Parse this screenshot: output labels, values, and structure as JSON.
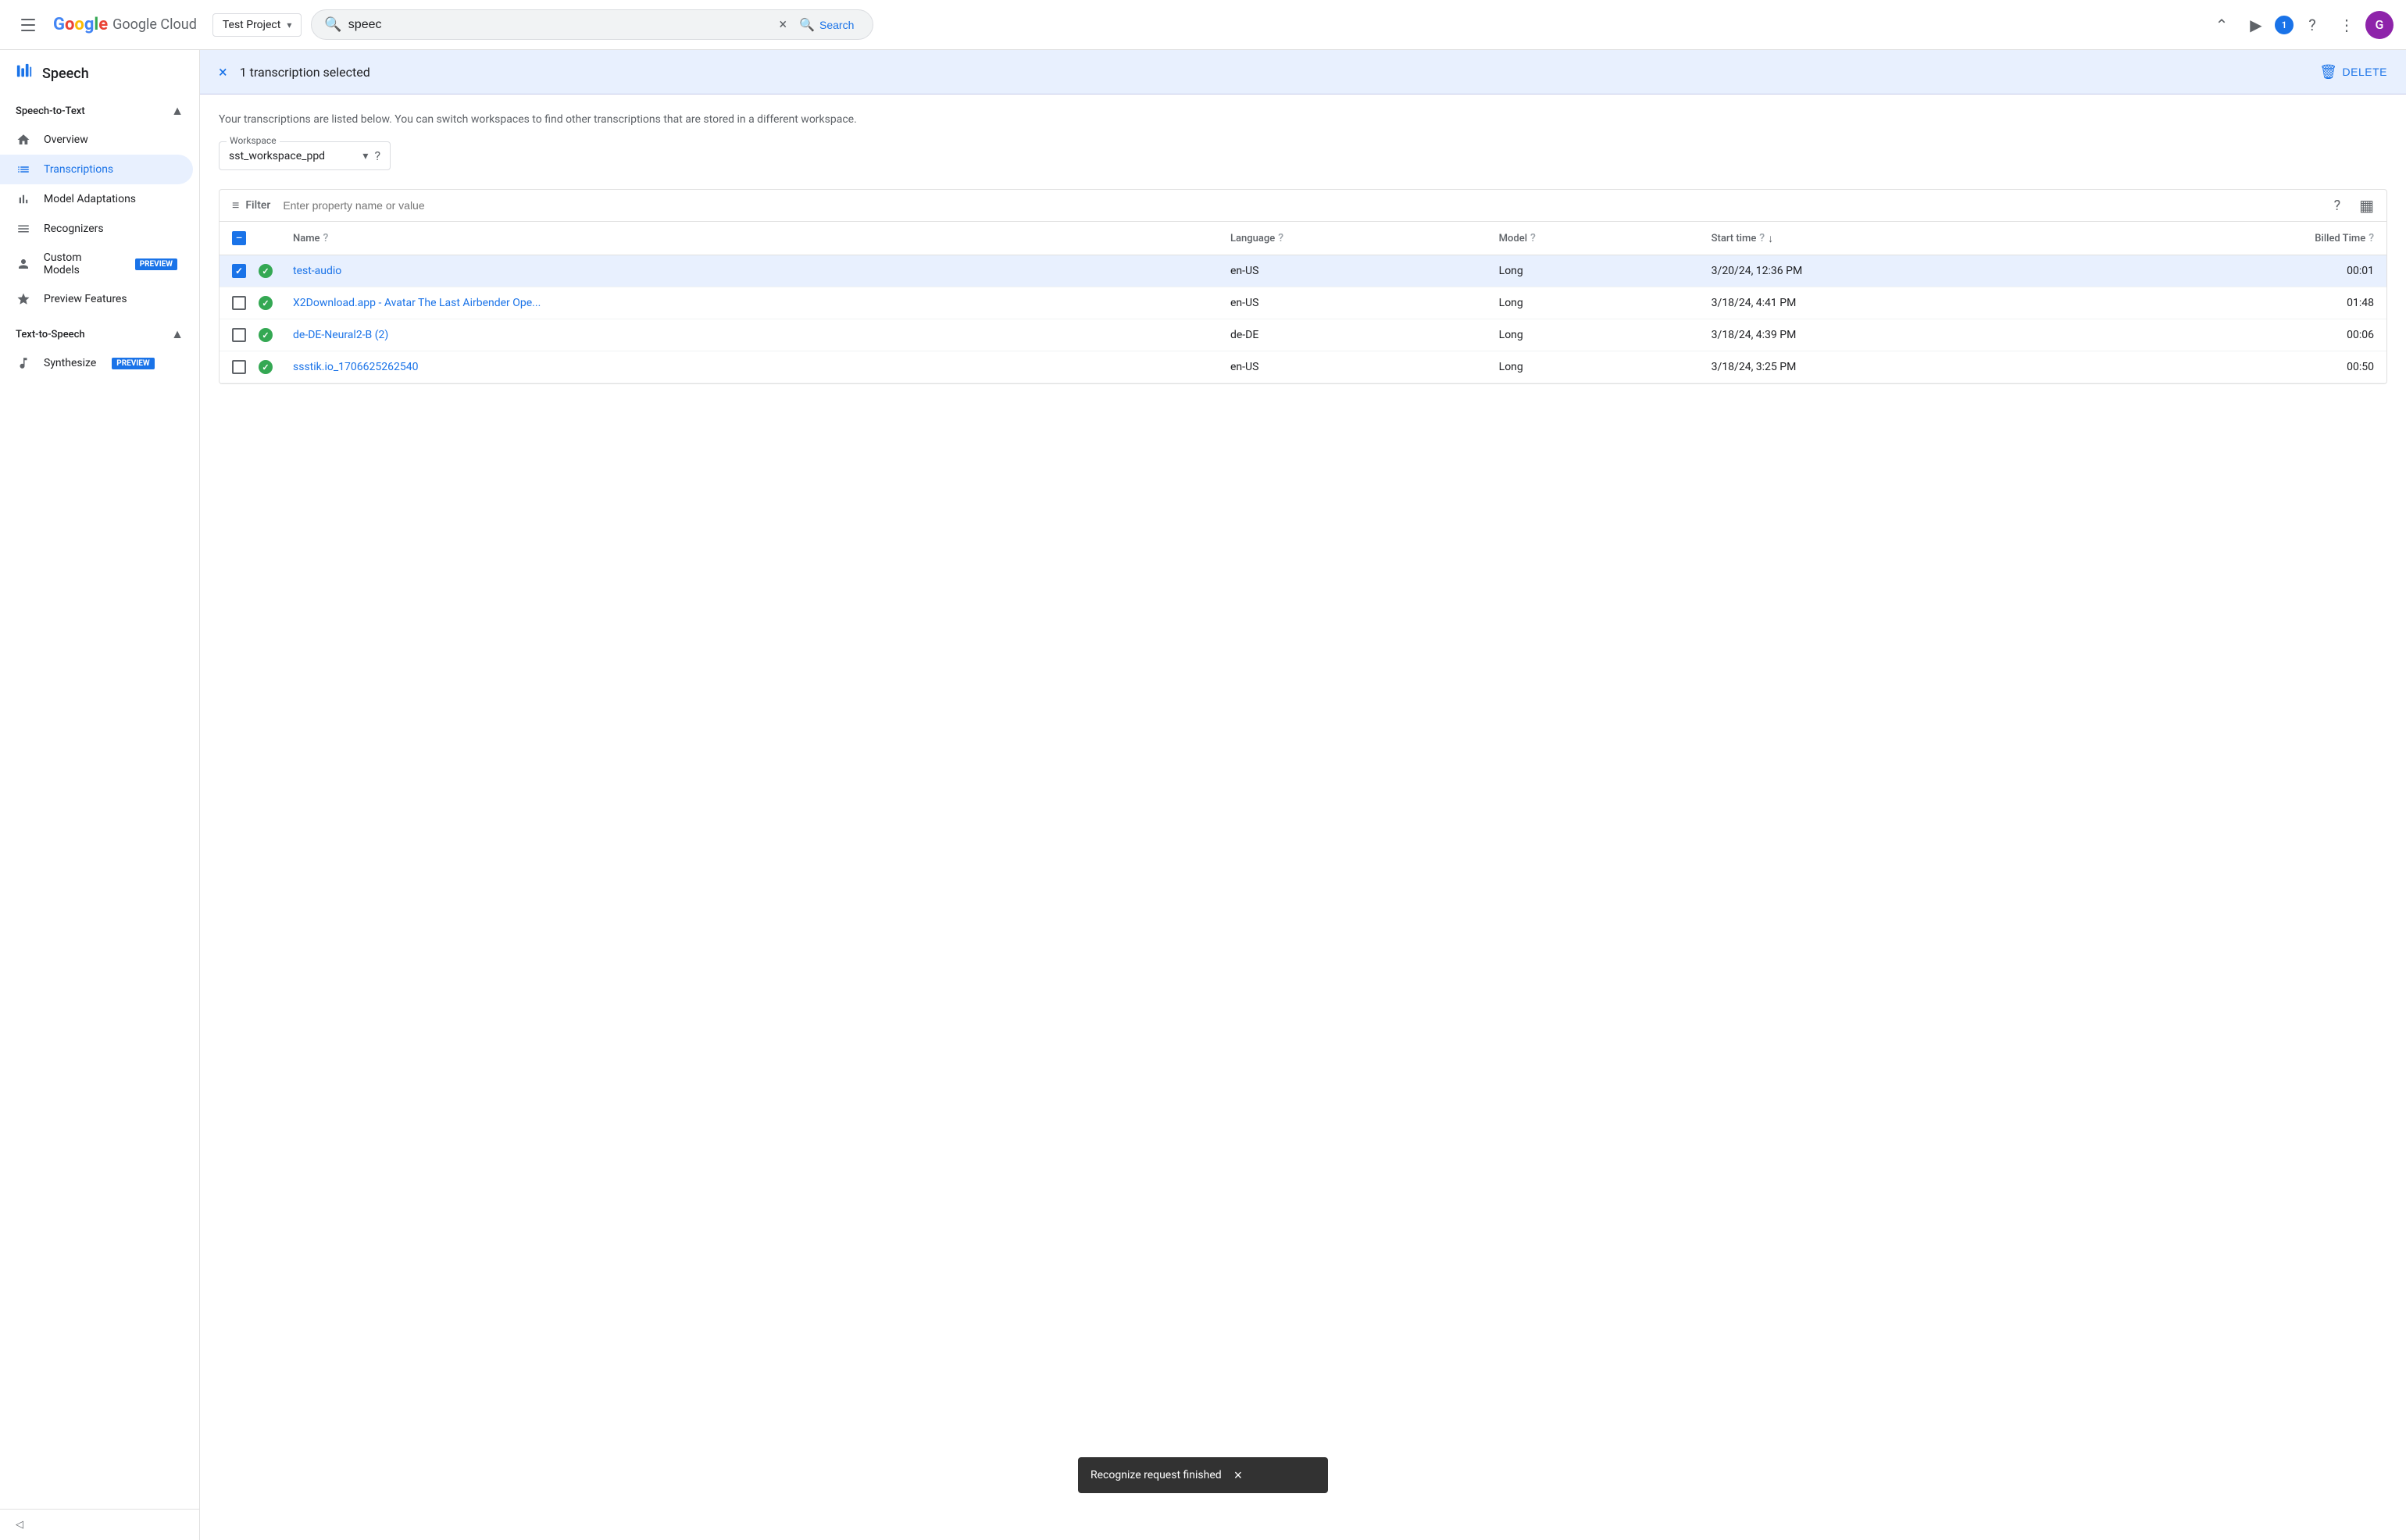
{
  "topbar": {
    "menu_label": "Main menu",
    "logo_text": "Google Cloud",
    "project": {
      "name": "Test Project",
      "chevron": "▾"
    },
    "search": {
      "value": "speec",
      "placeholder": "Search",
      "clear_label": "×",
      "button_label": "Search"
    },
    "actions": {
      "cloud_shell_label": "Activate Cloud Shell",
      "terminal_label": "Open Cloud Shell Editor",
      "notification_count": "1",
      "help_label": "Help",
      "more_label": "More options",
      "avatar_letter": "G"
    }
  },
  "sidebar": {
    "app_title": "Speech",
    "speech_to_text_section": "Speech-to-Text",
    "collapse_icon": "▲",
    "items": [
      {
        "id": "overview",
        "label": "Overview",
        "icon": "home"
      },
      {
        "id": "transcriptions",
        "label": "Transcriptions",
        "icon": "list",
        "active": true
      },
      {
        "id": "model-adaptations",
        "label": "Model Adaptations",
        "icon": "bar_chart"
      },
      {
        "id": "recognizers",
        "label": "Recognizers",
        "icon": "menu"
      },
      {
        "id": "custom-models",
        "label": "Custom Models",
        "icon": "person",
        "badge": "PREVIEW"
      },
      {
        "id": "preview-features",
        "label": "Preview Features",
        "icon": "star"
      }
    ],
    "text_to_speech_section": "Text-to-Speech",
    "tts_items": [
      {
        "id": "synthesize",
        "label": "Synthesize",
        "icon": "music_note",
        "badge": "PREVIEW"
      }
    ],
    "collapse_label": "Collapse navigation menu"
  },
  "selection_bar": {
    "close_label": "×",
    "text": "1 transcription selected",
    "delete_label": "DELETE"
  },
  "page": {
    "description": "Your transcriptions are listed below. You can switch workspaces to find other transcriptions that are stored in a different workspace.",
    "workspace_label": "Workspace",
    "workspace_value": "sst_workspace_ppd",
    "filter_label": "Filter",
    "filter_placeholder": "Enter property name or value",
    "table": {
      "columns": [
        {
          "id": "checkbox",
          "label": ""
        },
        {
          "id": "status",
          "label": ""
        },
        {
          "id": "name",
          "label": "Name",
          "help": true
        },
        {
          "id": "language",
          "label": "Language",
          "help": true
        },
        {
          "id": "model",
          "label": "Model",
          "help": true
        },
        {
          "id": "start_time",
          "label": "Start time",
          "help": true,
          "sort": true
        },
        {
          "id": "billed_time",
          "label": "Billed Time",
          "help": true
        }
      ],
      "rows": [
        {
          "id": "row-1",
          "selected": true,
          "status": "success",
          "name": "test-audio",
          "language": "en-US",
          "model": "Long",
          "start_time": "3/20/24, 12:36 PM",
          "billed_time": "00:01"
        },
        {
          "id": "row-2",
          "selected": false,
          "status": "success",
          "name": "X2Download.app - Avatar The Last Airbender Ope...",
          "language": "en-US",
          "model": "Long",
          "start_time": "3/18/24, 4:41 PM",
          "billed_time": "01:48"
        },
        {
          "id": "row-3",
          "selected": false,
          "status": "success",
          "name": "de-DE-Neural2-B (2)",
          "language": "de-DE",
          "model": "Long",
          "start_time": "3/18/24, 4:39 PM",
          "billed_time": "00:06"
        },
        {
          "id": "row-4",
          "selected": false,
          "status": "success",
          "name": "ssstik.io_1706625262540",
          "language": "en-US",
          "model": "Long",
          "start_time": "3/18/24, 3:25 PM",
          "billed_time": "00:50"
        }
      ]
    }
  },
  "snackbar": {
    "message": "Recognize request finished",
    "close_label": "×"
  },
  "colors": {
    "accent": "#1a73e8",
    "success": "#34A853",
    "selection_bg": "#e8f0fe"
  }
}
